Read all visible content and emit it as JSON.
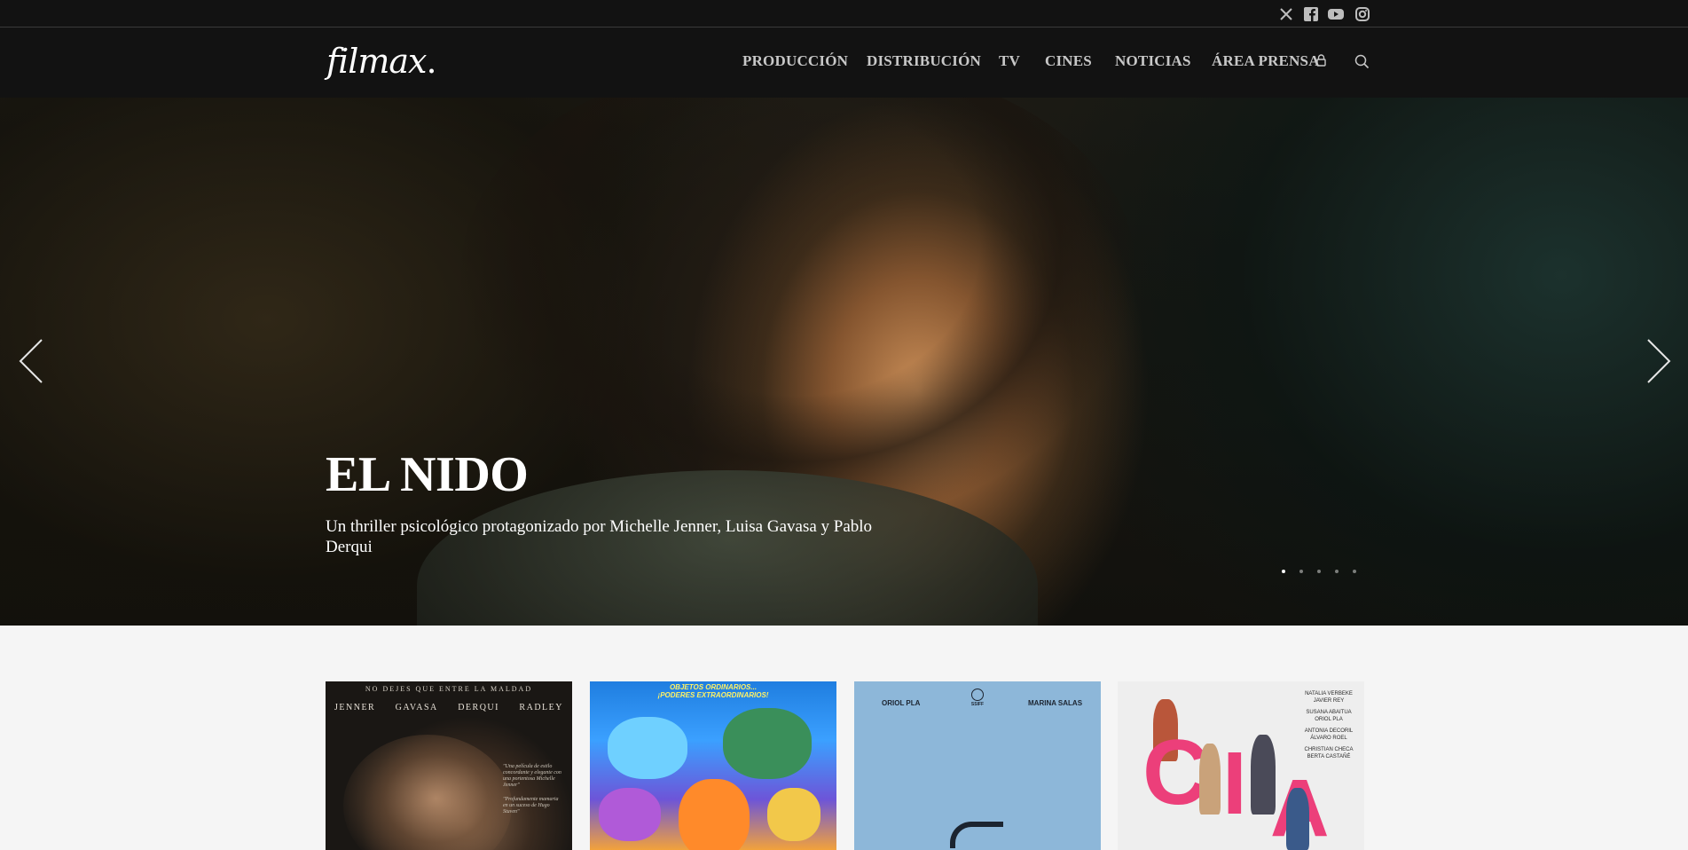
{
  "social": {
    "x_icon": "x-twitter-icon",
    "facebook_icon": "facebook-icon",
    "youtube_icon": "youtube-icon",
    "instagram_icon": "instagram-icon"
  },
  "brand": {
    "logo_text": "filmax",
    "logo_dot": "."
  },
  "nav": {
    "items": [
      "PRODUCCIÓN",
      "DISTRIBUCIÓN",
      "TV",
      "CINES",
      "NOTICIAS",
      "ÁREA PRENSA"
    ],
    "lock_icon": "lock-icon",
    "search_icon": "search-icon"
  },
  "hero": {
    "title": "EL NIDO",
    "subtitle": "Un thriller psicológico protagonizado por Michelle Jenner, Luisa Gavasa y Pablo Derqui",
    "prev_icon": "chevron-left-icon",
    "next_icon": "chevron-right-icon",
    "slide_count": 5,
    "active_slide": 1
  },
  "posters": [
    {
      "tagline": "NO DEJES QUE ENTRE LA MALDAD",
      "names": [
        "JENNER",
        "GAVASA",
        "DERQUI",
        "RADLEY"
      ],
      "quote": "\"Una película de estilo concordante y elegante con una portentosa Michelle Jenner\"",
      "quote2": "\"Profundamente mamaria en un suceso de Hugo Stuven\""
    },
    {
      "tagline_line1": "OBJETOS ORDINARIOS...",
      "tagline_line2": "¡PODERES EXTRAORDINARIOS!"
    },
    {
      "actor_left": "ORIOL PLA",
      "actor_right": "MARINA SALAS",
      "badge": "SSIFF"
    },
    {
      "credits": [
        "NATALIA VERBEKE JAVIER REY",
        "SUSANA ABAITUA ORIOL PLA",
        "ANTONIA DECORIL ÁLVARO ROEL",
        "CHRISTIAN CHECA BERTA CASTAÑÉ"
      ],
      "letters": [
        "C",
        "I",
        "A"
      ]
    }
  ],
  "colors": {
    "topbar": "#121212",
    "nav_text": "#c8c8c8",
    "page_bg": "#f5f5f5",
    "accent_pink": "#ec3f7a"
  }
}
